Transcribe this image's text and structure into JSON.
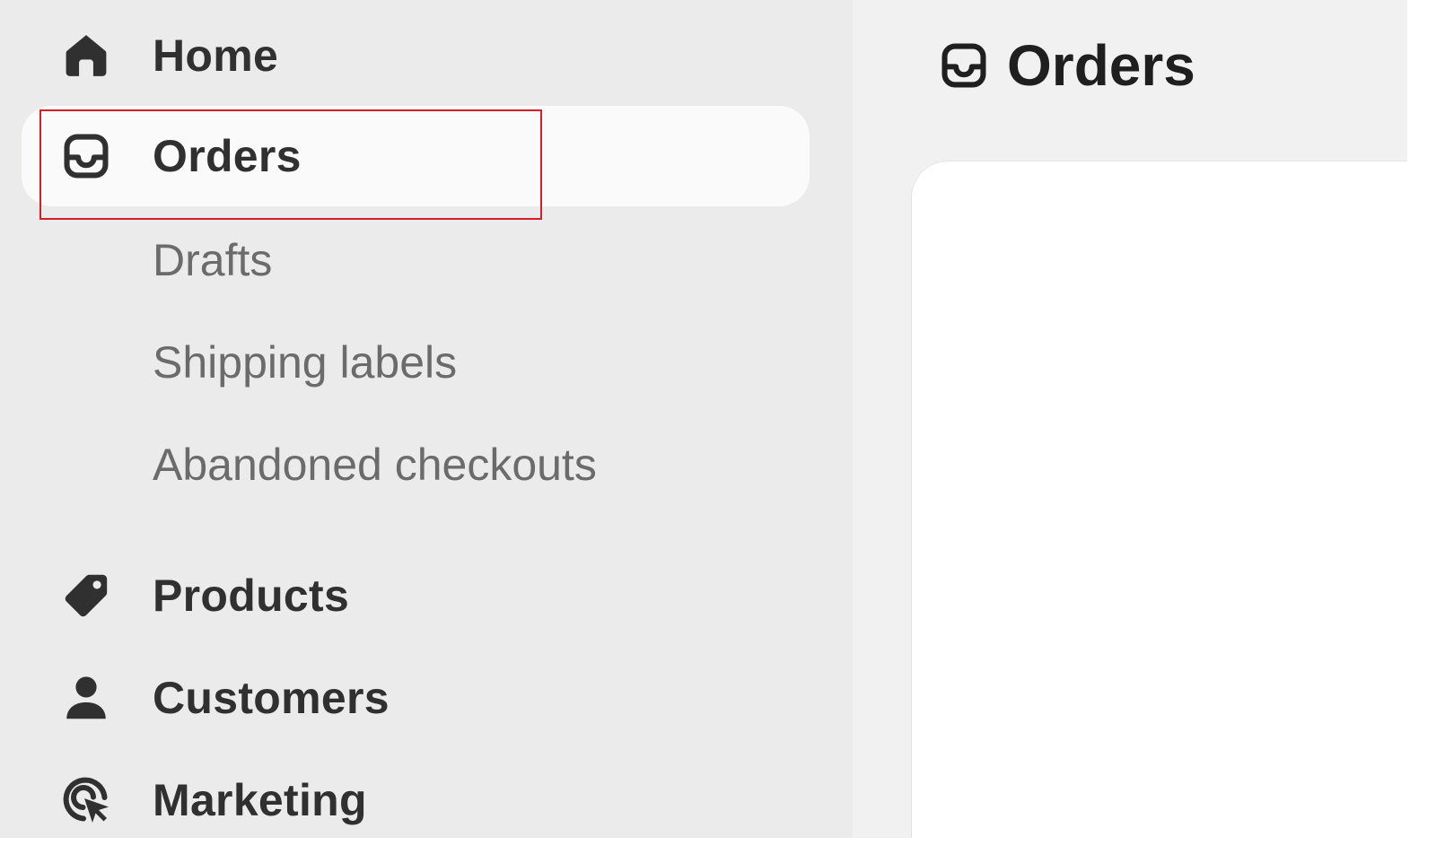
{
  "sidebar": {
    "items": [
      {
        "label": "Home",
        "icon": "home-icon"
      },
      {
        "label": "Orders",
        "icon": "orders-inbox-icon",
        "active": true
      },
      {
        "label": "Products",
        "icon": "tag-icon"
      },
      {
        "label": "Customers",
        "icon": "person-icon"
      },
      {
        "label": "Marketing",
        "icon": "target-cursor-icon"
      }
    ],
    "orders_subitems": [
      {
        "label": "Drafts"
      },
      {
        "label": "Shipping labels"
      },
      {
        "label": "Abandoned checkouts"
      }
    ]
  },
  "main": {
    "page_title": "Orders",
    "page_icon": "orders-inbox-icon"
  },
  "colors": {
    "sidebar_bg": "#ebebeb",
    "main_bg": "#f1f1f1",
    "active_item_bg": "#fafafa",
    "highlight": "#d21f2a",
    "text_primary": "#303030",
    "text_secondary": "#6b6b6b"
  }
}
